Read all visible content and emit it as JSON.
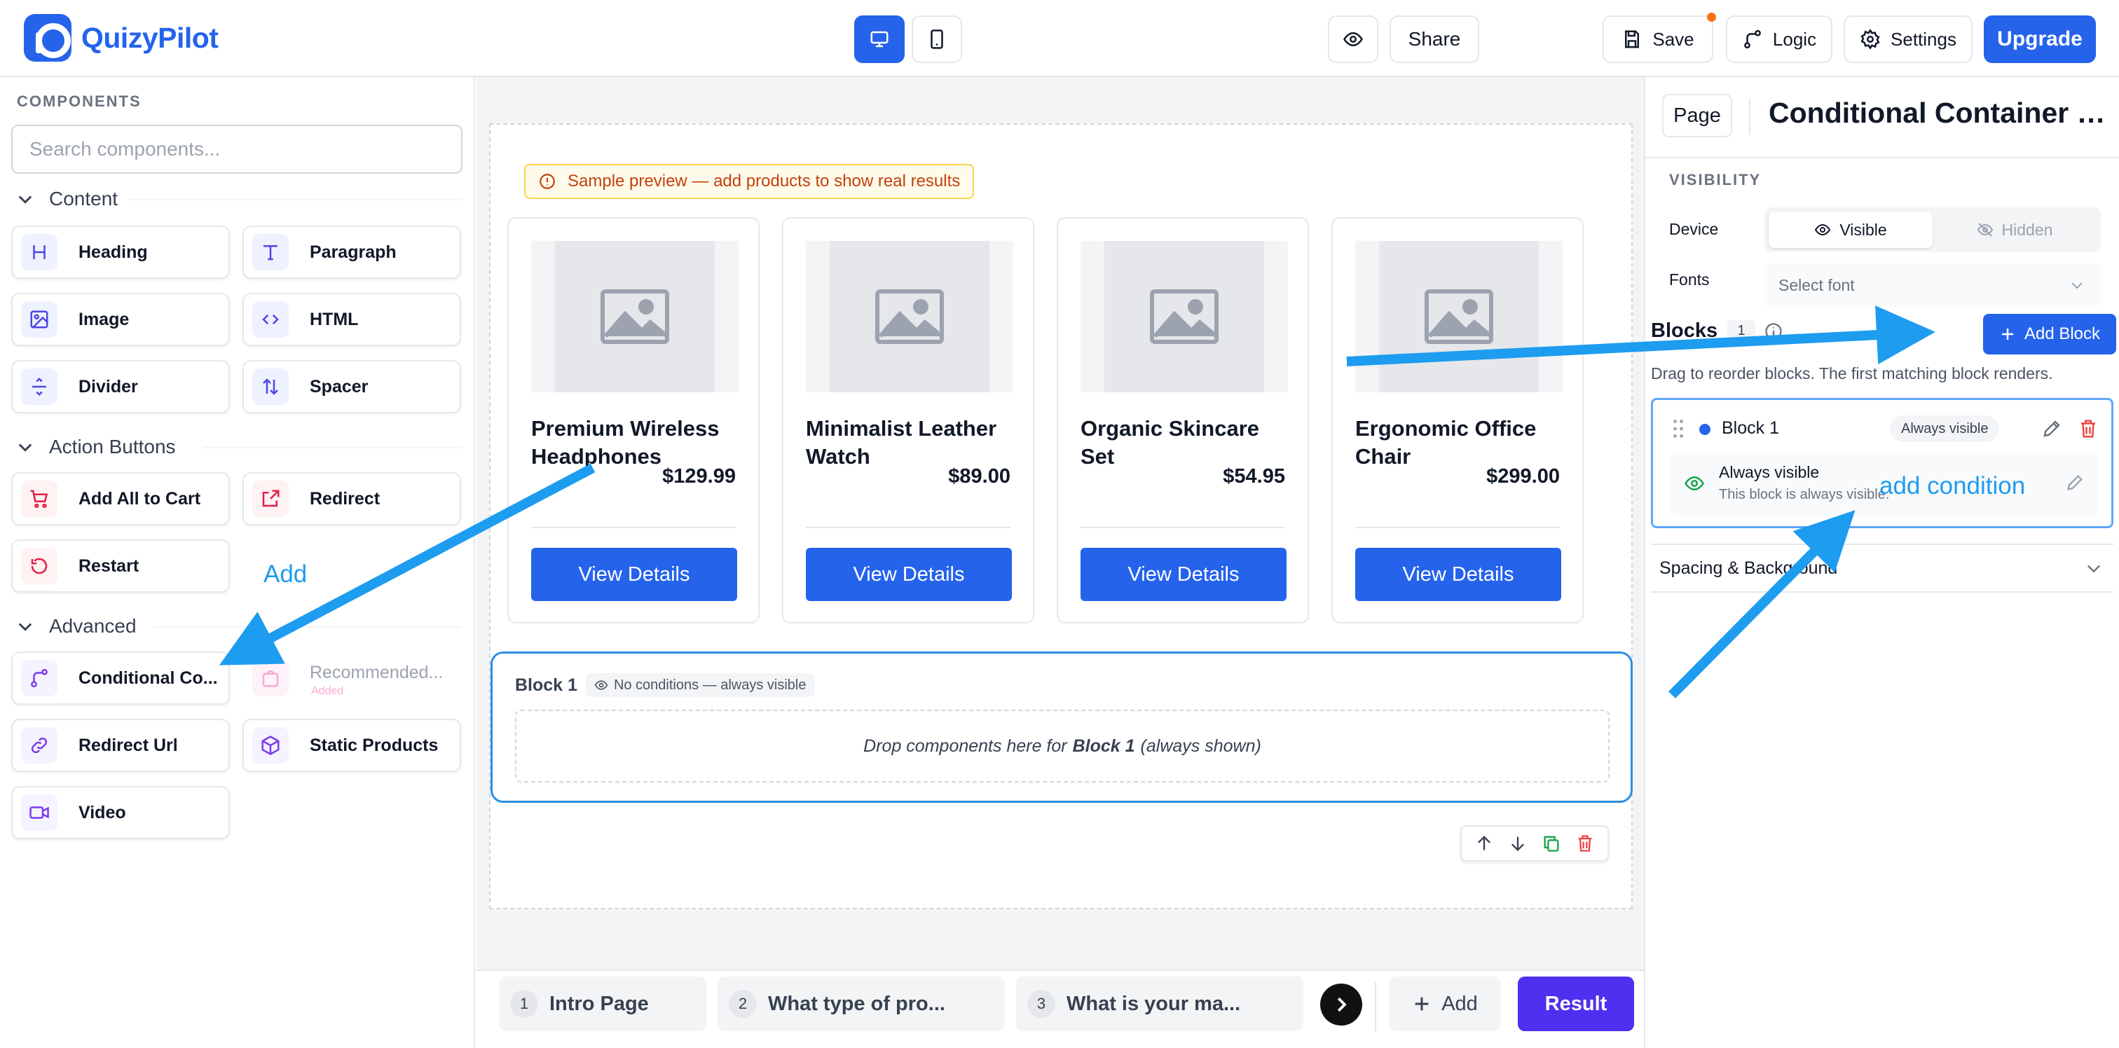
{
  "brand": {
    "name": "QuizyPilot",
    "accent": "#2563eb"
  },
  "topbar": {
    "share_label": "Share",
    "save_label": "Save",
    "logic_label": "Logic",
    "settings_label": "Settings",
    "upgrade_label": "Upgrade",
    "icons": [
      "desktop-icon",
      "mobile-icon",
      "eye-icon",
      "save-icon",
      "logic-icon",
      "gear-icon"
    ]
  },
  "sidebar": {
    "title": "COMPONENTS",
    "search_placeholder": "Search components...",
    "sections": [
      {
        "label": "Content",
        "items": [
          {
            "label": "Heading",
            "icon": "heading-icon"
          },
          {
            "label": "Paragraph",
            "icon": "text-icon"
          },
          {
            "label": "Image",
            "icon": "image-icon"
          },
          {
            "label": "HTML",
            "icon": "code-icon"
          },
          {
            "label": "Divider",
            "icon": "divider-icon"
          },
          {
            "label": "Spacer",
            "icon": "spacer-icon"
          }
        ]
      },
      {
        "label": "Action Buttons",
        "items": [
          {
            "label": "Add All to Cart",
            "icon": "cart-icon"
          },
          {
            "label": "Redirect",
            "icon": "external-link-icon"
          },
          {
            "label": "Restart",
            "icon": "restart-icon"
          }
        ]
      },
      {
        "label": "Advanced",
        "items": [
          {
            "label": "Conditional Co...",
            "icon": "branch-icon"
          },
          {
            "label": "Recommended...",
            "icon": "bag-icon",
            "status": "Added"
          },
          {
            "label": "Redirect Url",
            "icon": "link-icon"
          },
          {
            "label": "Static Products",
            "icon": "box-icon"
          },
          {
            "label": "Video",
            "icon": "video-icon"
          }
        ]
      }
    ]
  },
  "canvas": {
    "notice": "Sample preview — add products to show real results",
    "products": [
      {
        "title": "Premium Wireless Headphones",
        "price": "$129.99",
        "cta": "View Details"
      },
      {
        "title": "Minimalist Leather Watch",
        "price": "$89.00",
        "cta": "View Details"
      },
      {
        "title": "Organic Skincare Set",
        "price": "$54.95",
        "cta": "View Details"
      },
      {
        "title": "Ergonomic Office Chair",
        "price": "$299.00",
        "cta": "View Details"
      }
    ],
    "block": {
      "name": "Block 1",
      "badge": "No conditions — always visible",
      "drop_pre": "Drop components here for",
      "drop_bold": "Block 1",
      "drop_post": "(always shown)"
    }
  },
  "pagebar": {
    "tabs": [
      {
        "num": "1",
        "label": "Intro Page"
      },
      {
        "num": "2",
        "label": "What type of pro..."
      },
      {
        "num": "3",
        "label": "What is your ma..."
      }
    ],
    "add_label": "Add",
    "result_label": "Result"
  },
  "rpanel": {
    "page_label": "Page",
    "title": "Conditional Container S...",
    "visibility_title": "VISIBILITY",
    "device_label": "Device",
    "visible_label": "Visible",
    "hidden_label": "Hidden",
    "fonts_label": "Fonts",
    "font_placeholder": "Select font",
    "blocks_title": "Blocks",
    "blocks_count": "1",
    "add_block_label": "Add Block",
    "blocks_help": "Drag to reorder blocks. The first matching block renders.",
    "block_card": {
      "name": "Block 1",
      "badge": "Always visible",
      "cond_title": "Always visible",
      "cond_desc": "This block is always visible."
    },
    "spacing_label": "Spacing & Background"
  },
  "annotations": {
    "add": "Add",
    "add_condition": "add condition",
    "color": "#1e9cf0"
  }
}
